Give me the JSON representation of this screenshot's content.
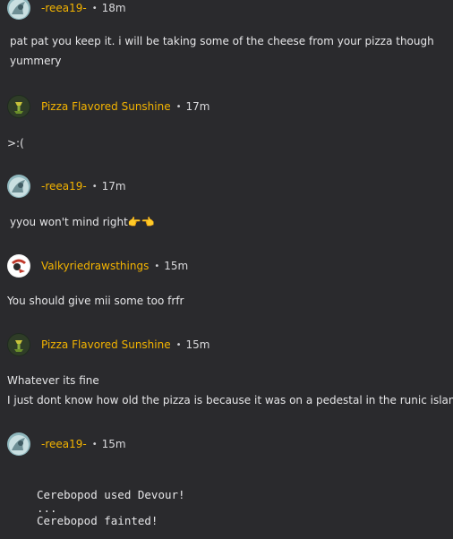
{
  "posts": [
    {
      "username": "-reea19-",
      "separator": "•",
      "time": "18m",
      "avatar_icon": "reea19-avatar-icon",
      "lines": [
        "pat pat you keep it. i will be taking some of the cheese from your pizza though",
        "yummery"
      ]
    },
    {
      "username": "Pizza Flavored Sunshine",
      "separator": "•",
      "time": "17m",
      "avatar_icon": "pizza-sunshine-avatar-icon",
      "lines": [
        ">:("
      ]
    },
    {
      "username": "-reea19-",
      "separator": "•",
      "time": "17m",
      "avatar_icon": "reea19-avatar-icon",
      "lines": [
        "yyou won't mind right👉👈"
      ]
    },
    {
      "username": "Valkyriedrawsthings",
      "separator": "•",
      "time": "15m",
      "avatar_icon": "valkyrie-avatar-icon",
      "lines": [
        "You should give mii some too frfr"
      ]
    },
    {
      "username": "Pizza Flavored Sunshine",
      "separator": "•",
      "time": "15m",
      "avatar_icon": "pizza-sunshine-avatar-icon",
      "lines": [
        "Whatever its fine",
        "I just dont know how old the pizza is because it was on a pedestal in the runic islands"
      ]
    },
    {
      "username": "-reea19-",
      "separator": "•",
      "time": "15m",
      "avatar_icon": "reea19-avatar-icon",
      "code_lines": [
        "Cerebopod used Devour!",
        "...",
        "Cerebopod fainted!"
      ]
    }
  ],
  "colors": {
    "background": "#2a2a2d",
    "username": "#f4b400",
    "text": "#e6e6e8"
  }
}
